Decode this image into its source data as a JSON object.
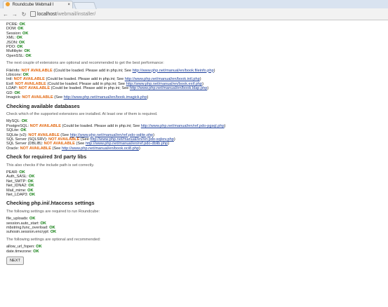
{
  "browser": {
    "tab_title": "Roundcube Webmail I",
    "tab_close": "×",
    "url_host": "localhost",
    "url_path": "/webmail/installer/"
  },
  "sections": {
    "required_exts": [
      {
        "name": "PCRE:",
        "status": "OK"
      },
      {
        "name": "DOM:",
        "status": "OK"
      },
      {
        "name": "Session:",
        "status": "OK"
      },
      {
        "name": "XML:",
        "status": "OK"
      },
      {
        "name": "JSON:",
        "status": "OK"
      },
      {
        "name": "PDO:",
        "status": "OK"
      },
      {
        "name": "Multibyte:",
        "status": "OK"
      },
      {
        "name": "OpenSSL:",
        "status": "OK"
      }
    ],
    "optional_note": "The next couple of extensions are optional and recommended to get the best performance:",
    "optional_exts": [
      {
        "name": "FileInfo:",
        "status": "NOT AVAILABLE",
        "msg": "(Could be loaded. Please add in php.ini; See",
        "link": "http://www.php.net/manual/en/book.fileinfo.php",
        "tail": ")"
      },
      {
        "name": "Libiconv:",
        "status": "OK"
      },
      {
        "name": "Intl:",
        "status": "NOT AVAILABLE",
        "msg": "(Could be loaded. Please add in php.ini; See",
        "link": "http://www.php.net/manual/en/book.intl.php",
        "tail": ")"
      },
      {
        "name": "Exif:",
        "status": "NOT AVAILABLE",
        "msg": "(Could be loaded. Please add in php.ini; See",
        "link": "http://www.php.net/manual/en/book.exif.php",
        "tail": ")"
      },
      {
        "name": "LDAP:",
        "status": "NOT AVAILABLE",
        "msg": "(Could be loaded. Please add in php.ini; See",
        "link": "http://www.php.net/manual/en/book.ldap.php",
        "tail": ")"
      },
      {
        "name": "GD:",
        "status": "OK"
      },
      {
        "name": "Imagick:",
        "status": "NOT AVAILABLE",
        "msg": "(See",
        "link": "http://www.php.net/manual/en/book.imagick.php",
        "tail": ")"
      }
    ],
    "db_title": "Checking available databases",
    "db_note": "Check which of the supported extensions are installed. At least one of them is required.",
    "dbs": [
      {
        "name": "MySQL:",
        "status": "OK"
      },
      {
        "name": "PostgreSQL:",
        "status": "NOT AVAILABLE",
        "msg": "(Could be loaded. Please add in php.ini; See",
        "link": "http://www.php.net/manual/en/ref.pdo-pgsql.php",
        "tail": ")"
      },
      {
        "name": "SQLite:",
        "status": "OK"
      },
      {
        "name": "SQLite (v2):",
        "status": "NOT AVAILABLE",
        "msg": "(See",
        "link": "http://www.php.net/manual/en/ref.pdo-sqlite.php",
        "tail": ")"
      },
      {
        "name": "SQL Server (SQLSRV):",
        "status": "NOT AVAILABLE",
        "msg": "(See",
        "link": "http://www.php.net/manual/en/ref.pdo-sqlsrv.php",
        "tail": ")"
      },
      {
        "name": "SQL Server (DBLIB):",
        "status": "NOT AVAILABLE",
        "msg": "(See",
        "link": "http://www.php.net/manual/en/ref.pdo-dblib.php",
        "tail": ")"
      },
      {
        "name": "Oracle:",
        "status": "NOT AVAILABLE",
        "msg": "(See",
        "link": "http://www.php.net/manual/en/book.oci8.php",
        "tail": ")"
      }
    ],
    "libs_title": "Check for required 3rd party libs",
    "libs_note": "This also checks if the include path is set correctly.",
    "libs": [
      {
        "name": "PEAR:",
        "status": "OK"
      },
      {
        "name": "Auth_SASL:",
        "status": "OK"
      },
      {
        "name": "Net_SMTP:",
        "status": "OK"
      },
      {
        "name": "Net_IDNA2:",
        "status": "OK"
      },
      {
        "name": "Mail_mime:",
        "status": "OK"
      },
      {
        "name": "Net_LDAP3:",
        "status": "OK"
      }
    ],
    "ini_title": "Checking php.ini/.htaccess settings",
    "ini_note_required": "The following settings are required to run Roundcube:",
    "ini_required": [
      {
        "name": "file_uploads:",
        "status": "OK"
      },
      {
        "name": "session.auto_start:",
        "status": "OK"
      },
      {
        "name": "mbstring.func_overload:",
        "status": "OK"
      },
      {
        "name": "suhosin.session.encrypt:",
        "status": "OK"
      }
    ],
    "ini_note_optional": "The following settings are optional and recommended:",
    "ini_optional": [
      {
        "name": "allow_url_fopen:",
        "status": "OK"
      },
      {
        "name": "date.timezone:",
        "status": "OK"
      }
    ]
  },
  "next_button": "NEXT"
}
